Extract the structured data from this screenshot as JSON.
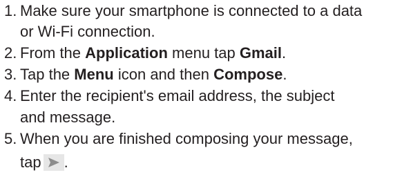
{
  "steps": [
    {
      "number": "1.",
      "lines": [
        "Make sure your smartphone is connected to a data",
        "or Wi-Fi connection."
      ]
    },
    {
      "number": "2.",
      "prefix": "From the ",
      "bold1": "Application",
      "middle": " menu tap ",
      "bold2": "Gmail",
      "suffix": "."
    },
    {
      "number": "3.",
      "prefix": "Tap the ",
      "bold1": "Menu",
      "middle": " icon and then ",
      "bold2": "Compose",
      "suffix": "."
    },
    {
      "number": "4.",
      "lines": [
        "Enter the recipient's email address, the subject",
        "and message."
      ]
    },
    {
      "number": "5.",
      "lines": [
        "When you are finished composing your message,",
        "tap"
      ],
      "end": ".",
      "icon": "send-icon"
    }
  ],
  "colors": {
    "text": "#231f20",
    "icon_background": "#e6e6e6",
    "icon_arrow": "#8c8c8c"
  }
}
